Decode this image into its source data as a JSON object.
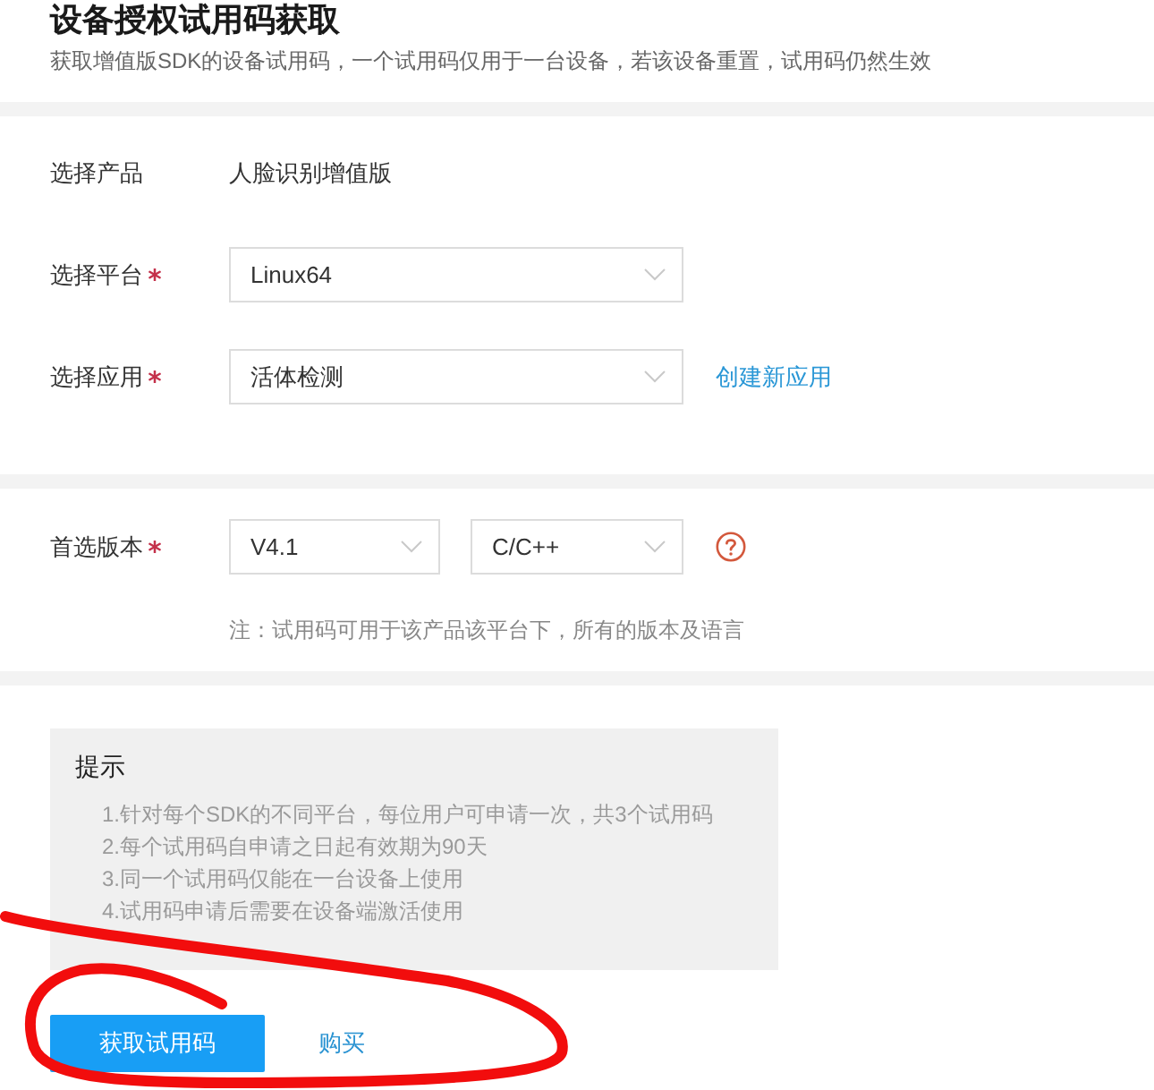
{
  "header": {
    "title": "设备授权试用码获取",
    "subtitle": "获取增值版SDK的设备试用码，一个试用码仅用于一台设备，若该设备重置，试用码仍然生效"
  },
  "sections": [
    {
      "rows": [
        {
          "kind": "text",
          "label": "选择产品",
          "required": false,
          "value": "人脸识别增值版"
        },
        {
          "kind": "select",
          "label": "选择平台",
          "required": true,
          "selects": [
            {
              "value": "Linux64"
            }
          ]
        },
        {
          "kind": "select",
          "label": "选择应用",
          "required": true,
          "selects": [
            {
              "value": "活体检测"
            }
          ],
          "link": "创建新应用"
        }
      ]
    },
    {
      "rows": [
        {
          "kind": "select",
          "label": "首选版本",
          "required": true,
          "selects": [
            {
              "value": "V4.1"
            },
            {
              "value": "C/C++"
            }
          ],
          "help": true
        }
      ],
      "note": "注：试用码可用于该产品该平台下，所有的版本及语言"
    }
  ],
  "tips": {
    "title": "提示",
    "items": [
      "1.针对每个SDK的不同平台，每位用户可申请一次，共3个试用码",
      "2.每个试用码自申请之日起有效期为90天",
      "3.同一个试用码仅能在一台设备上使用",
      "4.试用码申请后需要在设备端激活使用"
    ]
  },
  "actions": [
    {
      "kind": "primary",
      "label": "获取试用码"
    },
    {
      "kind": "link",
      "label": "购买"
    }
  ]
}
